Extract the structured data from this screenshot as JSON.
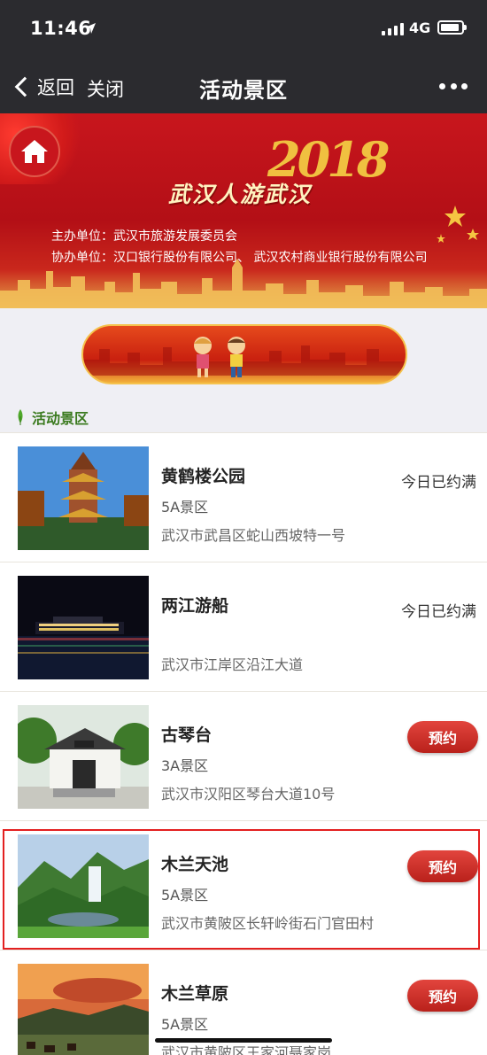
{
  "status": {
    "time": "11:46",
    "network": "4G"
  },
  "nav": {
    "back_label": "返回",
    "close_label": "关闭",
    "title": "活动景区"
  },
  "banner": {
    "year": "2018",
    "slogan": "武汉人游武汉",
    "host": "主办单位：武汉市旅游发展委员会",
    "coop": "协办单位：汉口银行股份有限公司、 武汉农村商业银行股份有限公司"
  },
  "section": {
    "label": "活动景区"
  },
  "spots": [
    {
      "name": "黄鹤楼公园",
      "grade": "5A景区",
      "address": "武汉市武昌区蛇山西坡特一号",
      "status": "今日已约满"
    },
    {
      "name": "两江游船",
      "grade": "",
      "address": "武汉市江岸区沿江大道",
      "status": "今日已约满"
    },
    {
      "name": "古琴台",
      "grade": "3A景区",
      "address": "武汉市汉阳区琴台大道10号",
      "status": "预约"
    },
    {
      "name": "木兰天池",
      "grade": "5A景区",
      "address": "武汉市黄陂区长轩岭街石门官田村",
      "status": "预约"
    },
    {
      "name": "木兰草原",
      "grade": "5A景区",
      "address": "武汉市黄陂区王家河聂家岗",
      "status": "预约"
    }
  ],
  "colors": {
    "nav_bg": "#2b2b2f",
    "banner_red": "#c8161d",
    "book_red": "#c9261f",
    "section_green": "#3a7a1e",
    "highlight": "#e32020"
  }
}
